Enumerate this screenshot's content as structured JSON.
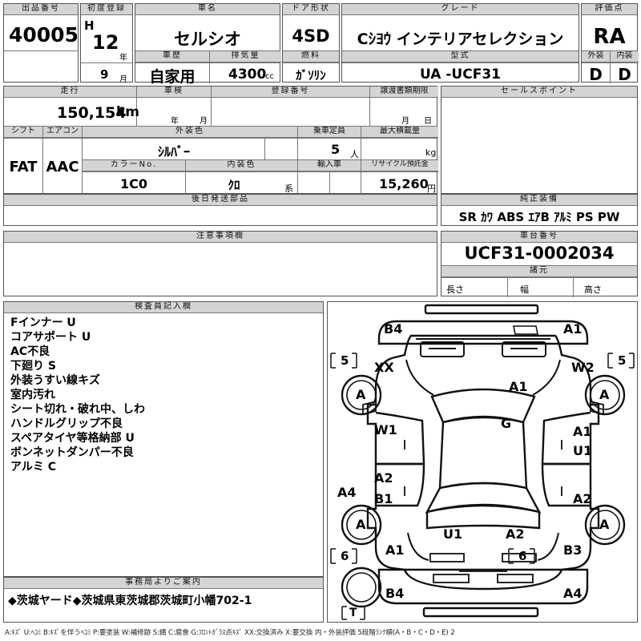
{
  "row1": {
    "lot_label": "出品番号",
    "lot_no": "40005",
    "reg_label": "初度登録",
    "era": "H",
    "year": "12",
    "year_unit": "年",
    "month": "9",
    "month_unit": "月",
    "name_label": "車名",
    "car_name": "セルシオ",
    "door_label": "ドア形状",
    "door": "4SD",
    "grade_label": "グレード",
    "grade": "Cｼﾖｳ インテリアセレクション",
    "score_label": "評価点",
    "score": "RA",
    "history_label": "車歴",
    "history": "自家用",
    "disp_label": "排気量",
    "disp": "4300",
    "disp_unit": "cc",
    "fuel_label": "燃料",
    "fuel": "ｶﾞｿﾘﾝ",
    "model_label": "型式",
    "model": "UA -UCF31",
    "ext_label": "外装",
    "ext": "D",
    "int_label": "内装",
    "int": "D"
  },
  "row2": {
    "mileage_label": "走行",
    "mileage": "150,154",
    "mileage_unit": "km",
    "inspect_label": "車検",
    "inspect_year_unit": "年",
    "inspect_month_unit": "月",
    "regno_label": "登録番号",
    "transfer_label": "譲渡書類期限",
    "transfer_month_unit": "月",
    "transfer_day_unit": "日",
    "sales_label": "セールスポイント"
  },
  "row3": {
    "shift_label": "シフト",
    "shift": "FAT",
    "ac_label": "エアコン",
    "ac": "AAC",
    "color_label": "外装色",
    "color": "ｼﾙﾊﾞｰ",
    "seats_label": "乗車定員",
    "seats": "5",
    "seats_unit": "人",
    "load_label": "最大積載量",
    "load_unit": "kg",
    "colorno_label": "カラーNo.",
    "colorno": "1C0",
    "intcolor_label": "内装色",
    "intcolor": "ｸﾛ",
    "intcolor_unit": "系",
    "import_label": "輸入車",
    "recycle_label": "リサイクル預託金",
    "recycle": "15,260",
    "recycle_unit": "円"
  },
  "parts_label": "後日発送部品",
  "equip_label": "純正装備",
  "equip": "SR ｶﾜ ABS ｴｱB ｱﾙﾐ PS PW",
  "notes_label": "注意事項欄",
  "chassis_label": "車台番号",
  "chassis": "UCF31-0002034",
  "specs_label": "諸元",
  "len_label": "長さ",
  "wid_label": "幅",
  "hgt_label": "高さ",
  "inspector_label": "検査員記入欄",
  "inspector_notes": [
    "Fインナー U",
    "コアサポート U",
    "AC不良",
    "下廻り S",
    "外装うすい線キズ",
    "室内汚れ",
    "シート切れ・破れ中、しわ",
    "ハンドルグリップ不良",
    "スペアタイヤ等格納部 U",
    "ボンネットダンパー不良",
    "アルミ C"
  ],
  "office_label": "事務局よりご案内",
  "office_msg": "◆茨城ヤード◆茨城県東茨城郡茨城町小幡702-1",
  "legend": "A:ｷｽﾞ U:ﾍｺﾐ B:ｷｽﾞを伴うﾍｺﾐ P:要塗装 W:補修跡 S:錆 C:腐食 G:ﾌﾛﾝﾄｶﾞﾗｽ点ｷｽﾞ XX:交換済み X:要交換 内・外装評価 5段階ﾗﾝｸ順(A・B・C・D・E) 2",
  "diagram": {
    "b4_top": "B4",
    "a1_top": "A1",
    "tag_5_left": "5",
    "tag_5_right": "5",
    "xx": "XX",
    "w2": "W2",
    "a_fl": "A",
    "a_fr": "A",
    "a1_hood": "A1",
    "g": "G",
    "w1": "W1",
    "a1_right": "A1",
    "u1_right": "U1",
    "a4": "A4",
    "a2_left": "A2",
    "b1": "B1",
    "a2_right": "A2",
    "a_rl": "A",
    "a_rr": "A",
    "u1_bottom": "U1",
    "a2_bottom": "A2",
    "a1_bottom": "A1",
    "b3": "B3",
    "tag_6_left": "6",
    "tag_6_right": "6",
    "b4_bottom": "B4",
    "a4_bottom": "A4",
    "tag_t": "T"
  }
}
